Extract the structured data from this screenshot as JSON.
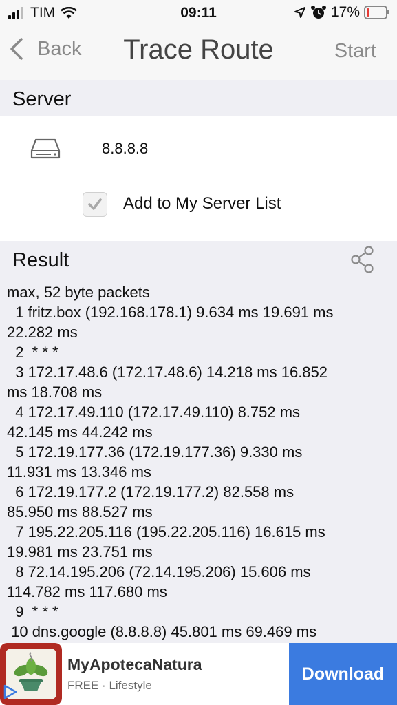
{
  "status_bar": {
    "carrier": "TIM",
    "time": "09:11",
    "battery_percent": "17%",
    "battery_level": 0.17,
    "battery_color": "#e53935"
  },
  "nav": {
    "back_label": "Back",
    "title": "Trace Route",
    "start_label": "Start"
  },
  "server_section": {
    "header": "Server",
    "server_value": "8.8.8.8",
    "add_to_list_label": "Add to My Server List",
    "add_to_list_checked": true
  },
  "result_section": {
    "header": "Result",
    "lines": [
      "max, 52 byte packets",
      "  1 fritz.box (192.168.178.1) 9.634 ms 19.691 ms",
      "22.282 ms",
      "  2  * * *",
      "  3 172.17.48.6 (172.17.48.6) 14.218 ms 16.852",
      "ms 18.708 ms",
      "  4 172.17.49.110 (172.17.49.110) 8.752 ms",
      "42.145 ms 44.242 ms",
      "  5 172.19.177.36 (172.19.177.36) 9.330 ms",
      "11.931 ms 13.346 ms",
      "  6 172.19.177.2 (172.19.177.2) 82.558 ms",
      "85.950 ms 88.527 ms",
      "  7 195.22.205.116 (195.22.205.116) 16.615 ms",
      "19.981 ms 23.751 ms",
      "  8 72.14.195.206 (72.14.195.206) 15.606 ms",
      "114.782 ms 117.680 ms",
      "  9  * * *",
      " 10 dns.google (8.8.8.8) 45.801 ms 69.469 ms"
    ]
  },
  "ad": {
    "app_name": "MyApotecaNatura",
    "subtitle": "FREE · Lifestyle",
    "cta": "Download",
    "cta_color": "#3b7be0"
  }
}
